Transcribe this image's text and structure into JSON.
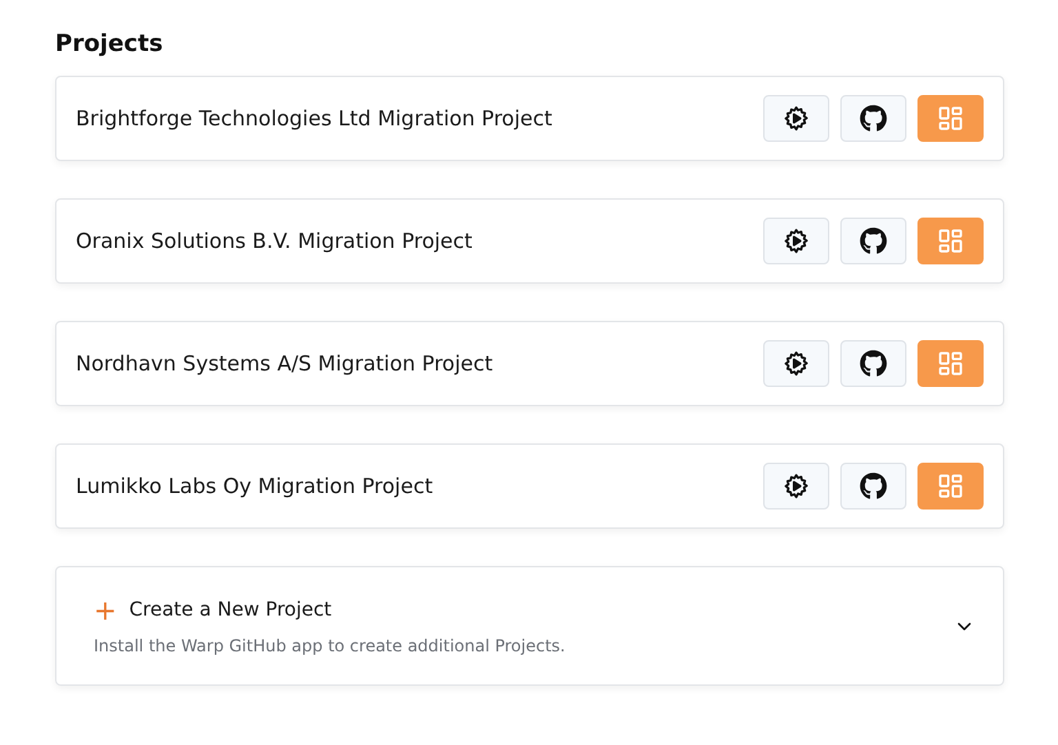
{
  "heading": "Projects",
  "projects": [
    {
      "name": "Brightforge Technologies Ltd Migration Project"
    },
    {
      "name": "Oranix Solutions B.V. Migration Project"
    },
    {
      "name": "Nordhavn Systems A/S Migration Project"
    },
    {
      "name": "Lumikko Labs Oy Migration Project"
    }
  ],
  "create": {
    "icon_text": "+",
    "title": "Create a New Project",
    "description": "Install the Warp GitHub app to create additional Projects.",
    "expanded": false
  }
}
